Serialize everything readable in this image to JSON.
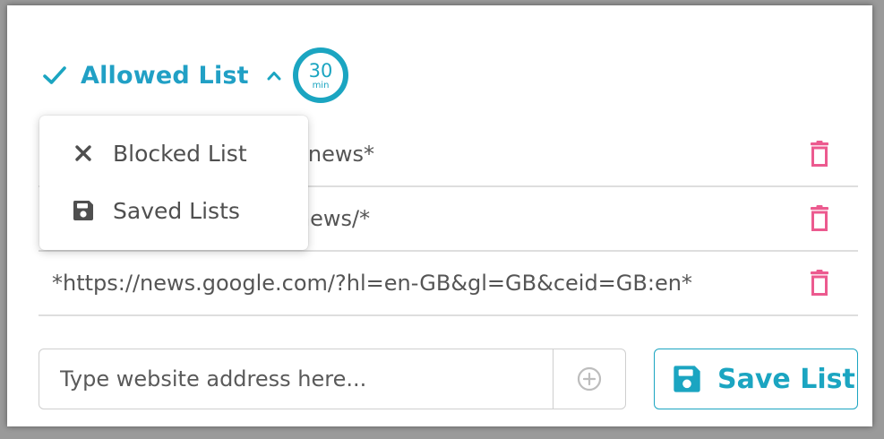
{
  "header": {
    "title": "Allowed List",
    "timer_value": "30",
    "timer_unit": "min"
  },
  "dropdown": {
    "items": [
      {
        "label": "Blocked List",
        "icon": "close-icon"
      },
      {
        "label": "Saved Lists",
        "icon": "save-icon"
      }
    ]
  },
  "list": {
    "entries": [
      {
        "url": "*https://www.bbc.co.uk/news*"
      },
      {
        "url": "*https://www.cnn.com/news/*"
      },
      {
        "url": "*https://news.google.com/?hl=en-GB&gl=GB&ceid=GB:en*"
      }
    ]
  },
  "form": {
    "placeholder": "Type website address here...",
    "save_label": "Save List"
  },
  "colors": {
    "accent": "#1ba5c1",
    "delete": "#ec5a8f",
    "text": "#555555"
  }
}
